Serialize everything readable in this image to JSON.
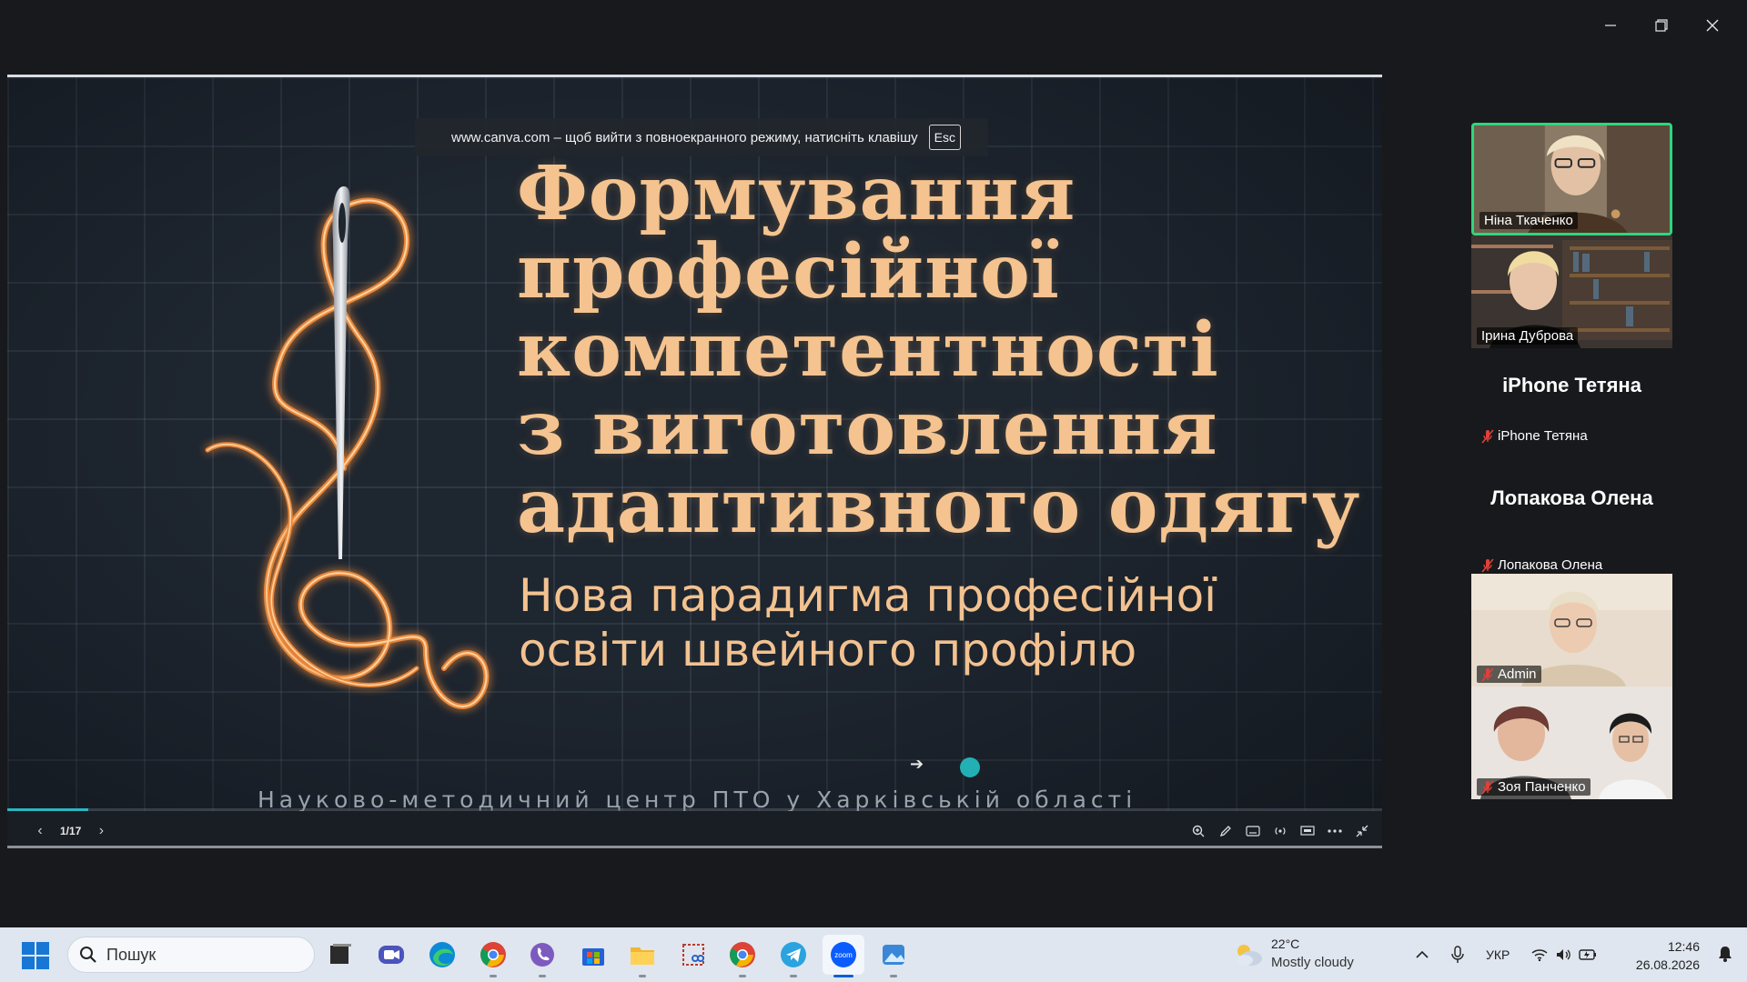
{
  "window": {
    "minimize_icon": "minimize-icon",
    "restore_icon": "restore-icon",
    "close_icon": "close-icon"
  },
  "slide": {
    "fullscreen_notice": "www.canva.com – щоб вийти з повноекранного режиму, натисніть клавішу",
    "esc_key": "Esc",
    "title_lines": [
      "Формування",
      "професійної",
      "компетентності",
      "з виготовлення",
      "адаптивного одягу"
    ],
    "subtitle_lines": [
      "Нова парадигма професійної",
      "освіти швейного профілю"
    ],
    "organization": "Науково-методичний центр ПТО у Харківській області",
    "progress_fraction": 0.059,
    "colors": {
      "title": "#f4c38f",
      "accent": "#2ab6c0",
      "background": "#1e2630"
    }
  },
  "player": {
    "prev_icon": "chevron-left-icon",
    "next_icon": "chevron-right-icon",
    "page_counter": "1/17",
    "tools": [
      "zoom-icon",
      "pen-icon",
      "keyboard-icon",
      "broadcast-icon",
      "present-icon",
      "more-icon",
      "exit-fullscreen-icon"
    ]
  },
  "participants": [
    {
      "name": "Ніна Ткаченко",
      "type": "video",
      "active": true,
      "muted": false
    },
    {
      "name": "Ірина Дуброва",
      "type": "video",
      "active": false,
      "muted": false
    },
    {
      "name": "iPhone Тетяна",
      "type": "name",
      "muted": true
    },
    {
      "name": "Лопакова Олена",
      "type": "name",
      "muted": true
    },
    {
      "name": "Admin",
      "type": "video",
      "muted": true
    },
    {
      "name": "Зоя Панченко",
      "type": "video",
      "muted": true
    }
  ],
  "taskbar": {
    "search_placeholder": "Пошук",
    "apps": [
      "task-view",
      "zoom-meetings",
      "edge",
      "chrome",
      "viber",
      "store",
      "file-explorer",
      "snipping-tool",
      "chrome-profile",
      "telegram",
      "zoom",
      "photos"
    ],
    "active_app": "zoom",
    "weather_temp": "22°C",
    "weather_condition": "Mostly cloudy",
    "language": "УКР",
    "time": "12:46",
    "date": "26.08.2026"
  }
}
